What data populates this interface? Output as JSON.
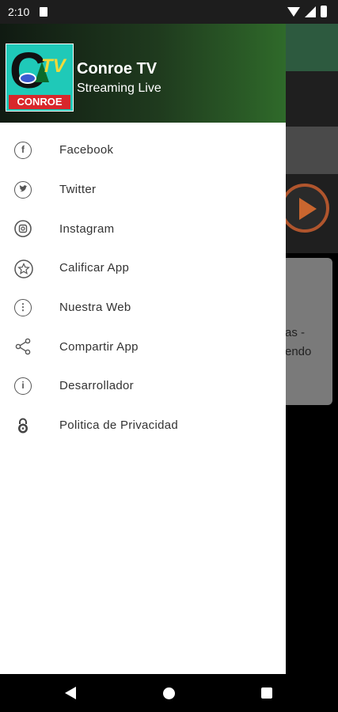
{
  "status_bar": {
    "time": "2:10",
    "icons": [
      "sd-card-icon",
      "wifi-icon",
      "signal-icon",
      "battery-icon"
    ]
  },
  "drawer": {
    "header": {
      "logo_letters": "C",
      "logo_tv": "TV",
      "logo_name": "CONROE",
      "title": "Conroe TV",
      "subtitle": "Streaming Live"
    },
    "items": [
      {
        "label": "Facebook",
        "icon": "facebook-icon"
      },
      {
        "label": "Twitter",
        "icon": "twitter-icon"
      },
      {
        "label": "Instagram",
        "icon": "instagram-icon"
      },
      {
        "label": "Calificar App",
        "icon": "star-icon"
      },
      {
        "label": "Nuestra Web",
        "icon": "web-icon"
      },
      {
        "label": "Compartir App",
        "icon": "share-icon"
      },
      {
        "label": "Desarrollador",
        "icon": "info-icon"
      },
      {
        "label": "Politica de Privacidad",
        "icon": "lock-icon"
      }
    ]
  },
  "background": {
    "card_line1": "as -",
    "card_line2": "endo"
  },
  "nav_bar": {
    "icons": [
      "back-icon",
      "home-icon",
      "recents-icon"
    ]
  },
  "colors": {
    "header_start": "#101a12",
    "header_end": "#2f6a2a",
    "logo_bg": "#1fc9b8",
    "logo_red": "#d8272b",
    "logo_yellow": "#f2d93a"
  }
}
